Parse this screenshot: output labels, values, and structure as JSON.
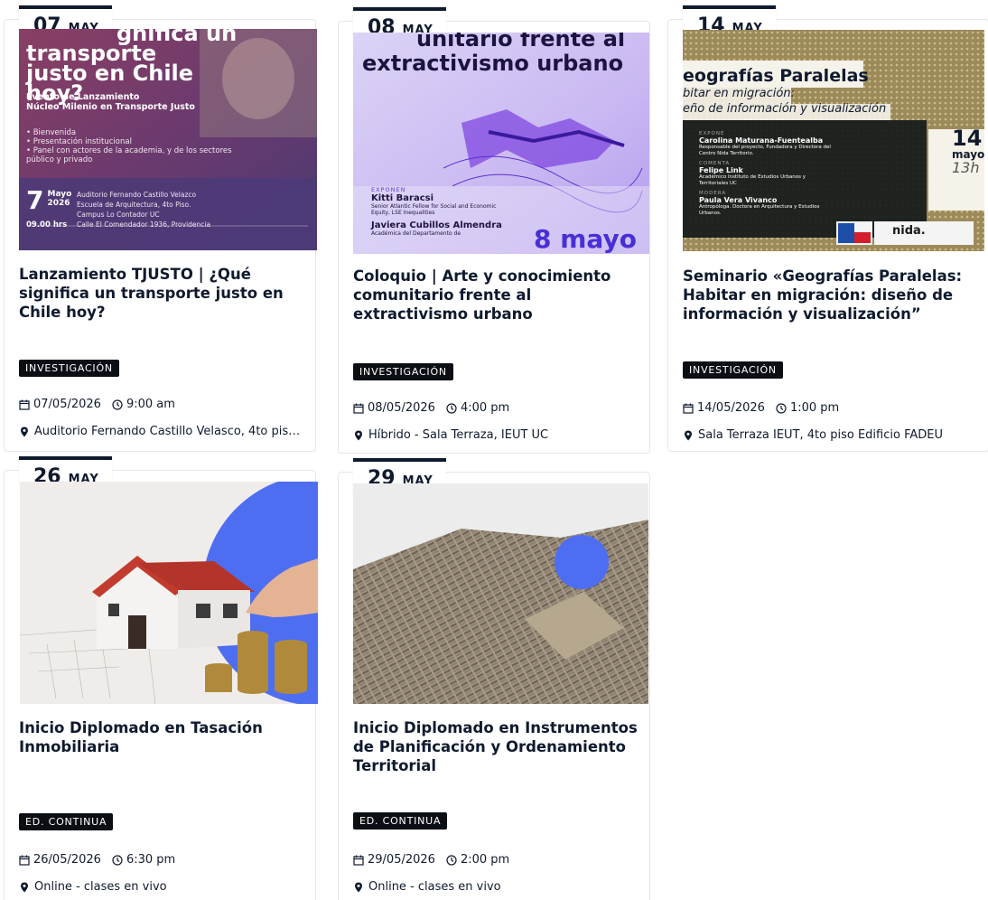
{
  "events": [
    {
      "day": "07",
      "month": "MAY",
      "title": "Lanzamiento TJUSTO | ¿Qué significa un transporte justo en Chile hoy?",
      "category": "INVESTIGACIÓN",
      "date": "07/05/2026",
      "time": "9:00 am",
      "location": "Auditorio Fernando Castillo Velasco, 4to piso…",
      "thumb": {
        "headline": "transporte justo en Chile hoy?",
        "headline_top": "gnifica un",
        "sub1": "Evento de Lanzamiento",
        "sub2": "Núcleo Milenio en Transporte Justo",
        "bullets": [
          "Bienvenida",
          "Presentación institucional",
          "Panel con actores de la academia, y de los sectores público y privado"
        ],
        "big_day": "7",
        "mayo": "Mayo",
        "year": "2026",
        "hour": "09.00 hrs",
        "venue_lines": [
          "Auditorio Fernando Castillo Velazco",
          "Escuela de Arquitectura, 4to Piso.",
          "Campus Lo Contador UC",
          "Calle El Comendador 1936, Providencia"
        ]
      }
    },
    {
      "day": "08",
      "month": "MAY",
      "title": "Coloquio | Arte y conocimiento comunitario frente al extractivismo urbano",
      "category": "INVESTIGACIÓN",
      "date": "08/05/2026",
      "time": "4:00 pm",
      "location": "Híbrido - Sala Terraza, IEUT UC",
      "thumb": {
        "headline_top": "unitario frente al",
        "headline": "extractivismo urbano",
        "exponen": "EXPONEN",
        "speaker1": "Kitti Baracsi",
        "speaker1_role": "Senior Atlantic Fellow for Social and Economic Equity, LSE Inequalities",
        "speaker2": "Javiera Cubillos Almendra",
        "speaker2_role": "Académica del Departamento de",
        "big_date": "8 mayo"
      }
    },
    {
      "day": "14",
      "month": "MAY",
      "title": "Seminario «Geografías Paralelas: Habitar en migración: diseño de información y visualización”",
      "category": "INVESTIGACIÓN",
      "date": "14/05/2026",
      "time": "1:00 pm",
      "location": "Sala Terraza IEUT, 4to piso Edificio FADEU",
      "thumb": {
        "headline": "eografías Paralelas",
        "sub1": "bitar en migración:",
        "sub2": "eño de información y visualización",
        "expone": "EXPONE",
        "p1": "Carolina Maturana-Fuentealba",
        "p1_role": "Responsable del proyecto, Fundadora y Directora del Centro Nida Territorio.",
        "comenta": "COMENTA",
        "p2": "Felipe Link",
        "p2_role": "Académico Instituto de Estudios Urbanos y Territoriales UC",
        "modera": "MODERA",
        "p3": "Paula Vera Vivanco",
        "p3_role": "Antropóloga. Doctora en Arquitectura y Estudios Urbanos.",
        "big_day": "14",
        "big_mon": "mayo",
        "big_hour": "13h",
        "logo": "nida."
      }
    },
    {
      "day": "26",
      "month": "MAY",
      "title": "Inicio Diplomado en Tasación Inmobiliaria",
      "category": "ED. CONTINUA",
      "date": "26/05/2026",
      "time": "6:30 pm",
      "location": "Online - clases en vivo"
    },
    {
      "day": "29",
      "month": "MAY",
      "title": "Inicio Diplomado en Instrumentos de Planificación y Ordenamiento Territorial",
      "category": "ED. CONTINUA",
      "date": "29/05/2026",
      "time": "2:00 pm",
      "location": "Online - clases en vivo"
    }
  ],
  "icons": {
    "calendar": "calendar-icon",
    "clock": "clock-icon",
    "location": "map-pin-icon"
  }
}
